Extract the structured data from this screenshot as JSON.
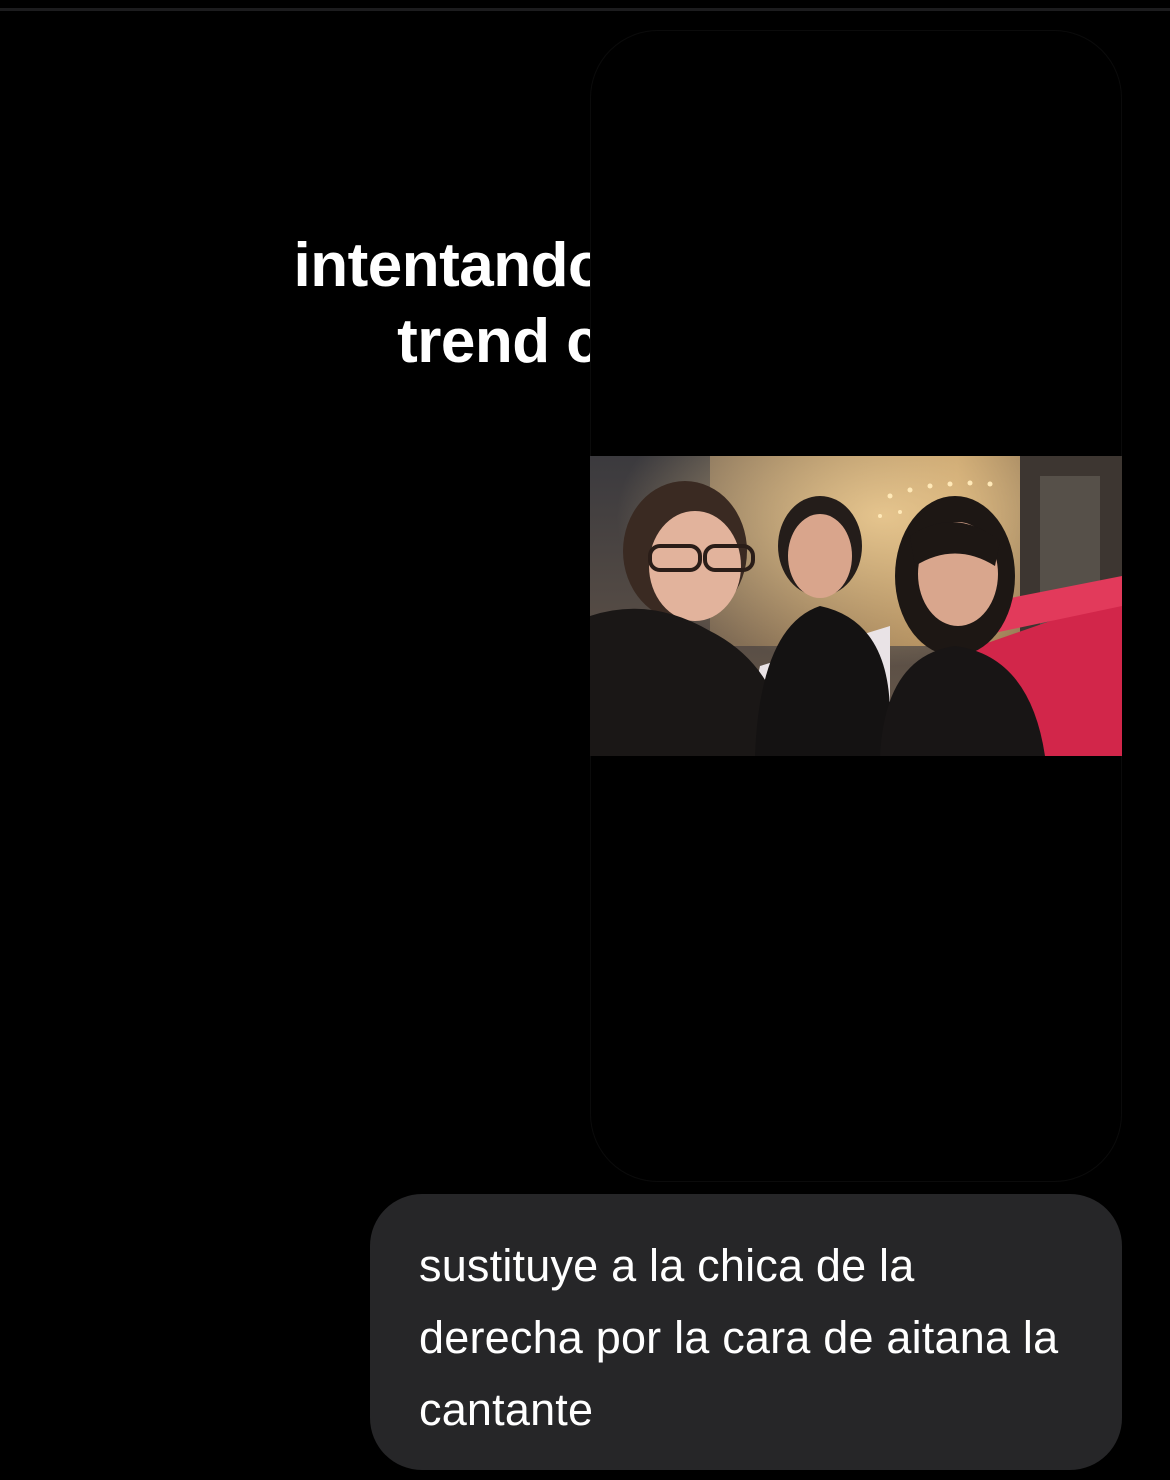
{
  "caption": {
    "line1": "intentando hacer un",
    "line2": "trend con IA:"
  },
  "photo": {
    "icon": "selfie-photo",
    "subjects": 3
  },
  "message": {
    "text": "sustituye a la chica de la derecha por la cara de aitana la cantante"
  },
  "colors": {
    "background": "#000000",
    "bubble": "#262628",
    "text": "#ffffff",
    "red_carpet": "#d2264a"
  }
}
